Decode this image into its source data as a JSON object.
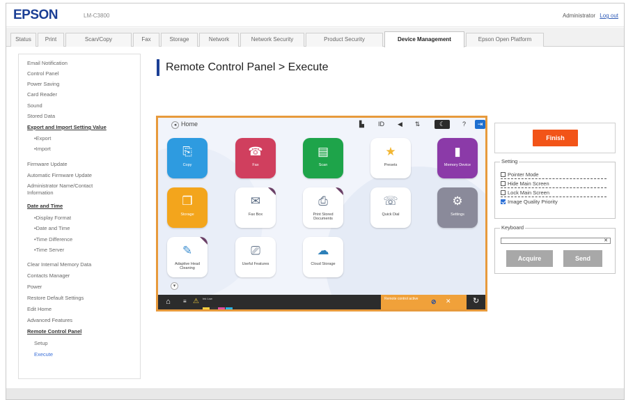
{
  "header": {
    "logo": "EPSON",
    "model": "LM-C3800",
    "admin_label": "Administrator",
    "logout_label": "Log out"
  },
  "tabs": [
    {
      "label": "Status"
    },
    {
      "label": "Print"
    },
    {
      "label": "Scan/Copy"
    },
    {
      "label": "Fax"
    },
    {
      "label": "Storage"
    },
    {
      "label": "Network"
    },
    {
      "label": "Network Security"
    },
    {
      "label": "Product Security"
    },
    {
      "label": "Device Management",
      "active": true
    },
    {
      "label": "Epson Open Platform"
    }
  ],
  "sidebar": {
    "items": [
      {
        "label": "Email Notification"
      },
      {
        "label": "Control Panel"
      },
      {
        "label": "Power Saving"
      },
      {
        "label": "Card Reader"
      },
      {
        "label": "Sound"
      },
      {
        "label": "Stored Data"
      },
      {
        "label": "Export and Import Setting Value"
      },
      {
        "label": "•Export"
      },
      {
        "label": "•Import"
      },
      {
        "label": "Firmware Update"
      },
      {
        "label": "Automatic Firmware Update"
      },
      {
        "label": "Administrator Name/Contact"
      },
      {
        "label": "Information"
      },
      {
        "label": "Date and Time"
      },
      {
        "label": "•Display Format"
      },
      {
        "label": "•Date and Time"
      },
      {
        "label": "•Time Difference"
      },
      {
        "label": "•Time Server"
      },
      {
        "label": "Clear Internal Memory Data"
      },
      {
        "label": "Contacts Manager"
      },
      {
        "label": "Power"
      },
      {
        "label": "Restore Default Settings"
      },
      {
        "label": "Edit Home"
      },
      {
        "label": "Advanced Features"
      },
      {
        "label": "Remote Control Panel"
      },
      {
        "label": "Setup"
      },
      {
        "label": "Execute"
      }
    ]
  },
  "main": {
    "title": "Remote Control Panel > Execute"
  },
  "panel": {
    "home_label": "Home",
    "apps": [
      {
        "label": "Copy",
        "icon": "copy-icon",
        "glyph": "⎘",
        "color": "#2e9be0"
      },
      {
        "label": "Fax",
        "icon": "fax-icon",
        "glyph": "☎",
        "color": "#d03f5e"
      },
      {
        "label": "Scan",
        "icon": "scan-icon",
        "glyph": "▤",
        "color": "#1ea44a"
      },
      {
        "label": "Presets",
        "icon": "presets-icon",
        "glyph": "★",
        "color": "#ffffff"
      },
      {
        "label": "Memory Device",
        "icon": "memory-device-icon",
        "glyph": "▮",
        "color": "#8b3aa8"
      },
      {
        "label": "Storage",
        "icon": "storage-icon",
        "glyph": "❒",
        "color": "#f3a51c"
      },
      {
        "label": "Fax Box",
        "icon": "fax-box-icon",
        "glyph": "✉",
        "color": "#ffffff"
      },
      {
        "label": "Print Stored Documents",
        "icon": "print-stored-documents-icon",
        "glyph": "⎙",
        "color": "#ffffff"
      },
      {
        "label": "Quick Dial",
        "icon": "quick-dial-icon",
        "glyph": "☏",
        "color": "#ffffff"
      },
      {
        "label": "Settings",
        "icon": "settings-icon",
        "glyph": "⚙",
        "color": "#8a8a9a"
      },
      {
        "label": "Adaptive Head Cleaning",
        "icon": "head-cleaning-icon",
        "glyph": "✎",
        "color": "#ffffff"
      },
      {
        "label": "Useful Features",
        "icon": "useful-features-icon",
        "glyph": "⎚",
        "color": "#ffffff"
      },
      {
        "label": "Cloud Storage",
        "icon": "cloud-storage-icon",
        "glyph": "☁",
        "color": "#ffffff"
      }
    ],
    "bottom": {
      "ink_label": "Ink Low",
      "status_text": "Remote control active",
      "ink_colors": [
        "#f4d03f",
        "#333333",
        "#e04fa0",
        "#2ab3e6"
      ]
    }
  },
  "controls": {
    "finish_label": "Finish",
    "setting_legend": "Setting",
    "options": [
      {
        "label": "Pointer Mode",
        "checked": false
      },
      {
        "label": "Hide Main Screen",
        "checked": false
      },
      {
        "label": "Lock Main Screen",
        "checked": false
      },
      {
        "label": "Image Quality Priority",
        "checked": true
      }
    ],
    "keyboard_legend": "Keyboard",
    "keyboard_value": "",
    "acquire_label": "Acquire",
    "send_label": "Send"
  }
}
